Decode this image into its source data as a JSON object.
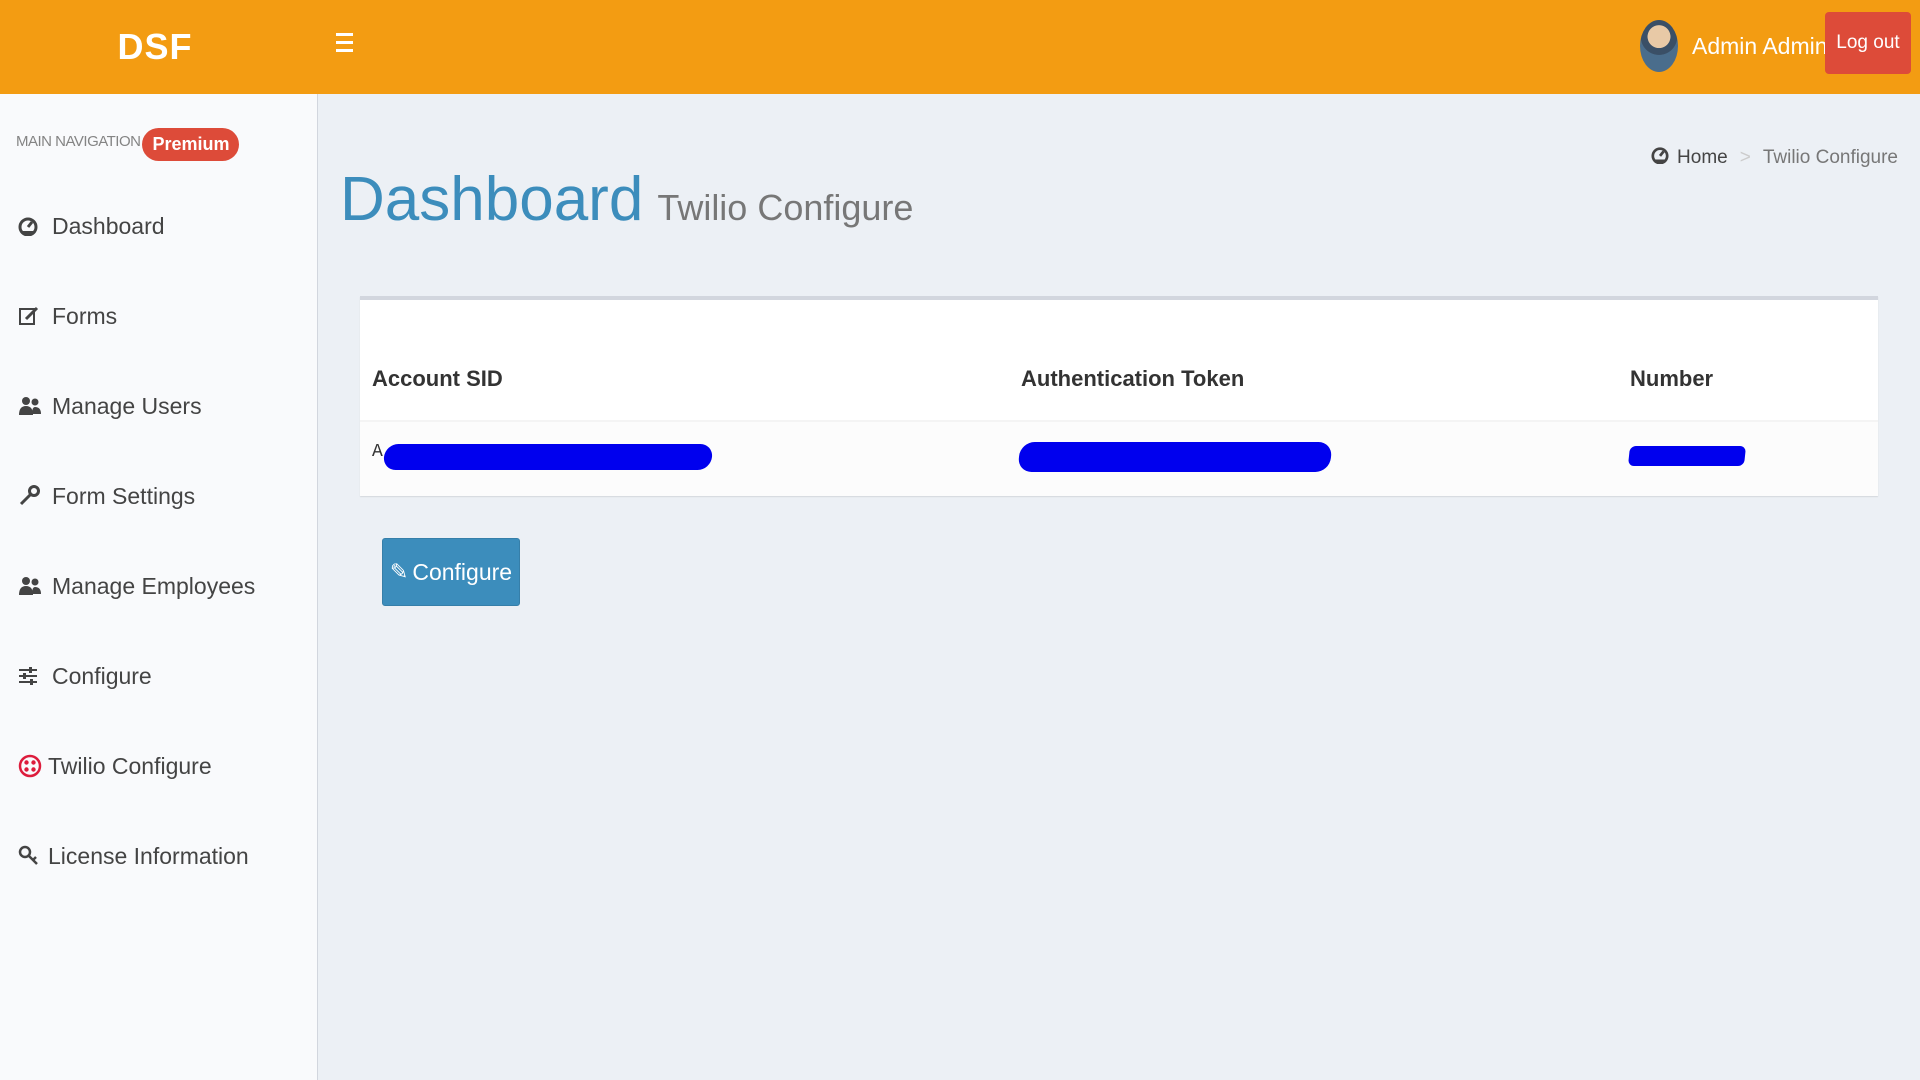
{
  "header": {
    "logo": "DSF",
    "user_name": "Admin Admin",
    "logout_label": "Log out",
    "brand_color": "#f39c12",
    "logout_color": "#dd4b39"
  },
  "sidebar": {
    "header": "MAIN NAVIGATION",
    "badge": "Premium",
    "items": [
      {
        "label": "Dashboard",
        "icon": "dashboard-icon"
      },
      {
        "label": "Forms",
        "icon": "edit-icon"
      },
      {
        "label": "Manage Users",
        "icon": "users-icon"
      },
      {
        "label": "Form Settings",
        "icon": "wrench-icon"
      },
      {
        "label": "Manage Employees",
        "icon": "users-icon"
      },
      {
        "label": "Configure",
        "icon": "sliders-icon"
      },
      {
        "label": "Twilio Configure",
        "icon": "twilio-icon"
      },
      {
        "label": "License Information",
        "icon": "key-icon"
      }
    ]
  },
  "page": {
    "title": "Dashboard",
    "subtitle": "Twilio Configure",
    "title_color": "#3c8dbc"
  },
  "breadcrumb": {
    "home": "Home",
    "current": "Twilio Configure"
  },
  "table": {
    "columns": [
      "Account SID",
      "Authentication Token",
      "Number"
    ],
    "row": {
      "account_sid_visible": "A",
      "auth_token_visible": "",
      "number_visible": "",
      "redaction_color": "#0000ee"
    }
  },
  "actions": {
    "configure_label": "Configure",
    "button_color": "#3c8dbc"
  }
}
